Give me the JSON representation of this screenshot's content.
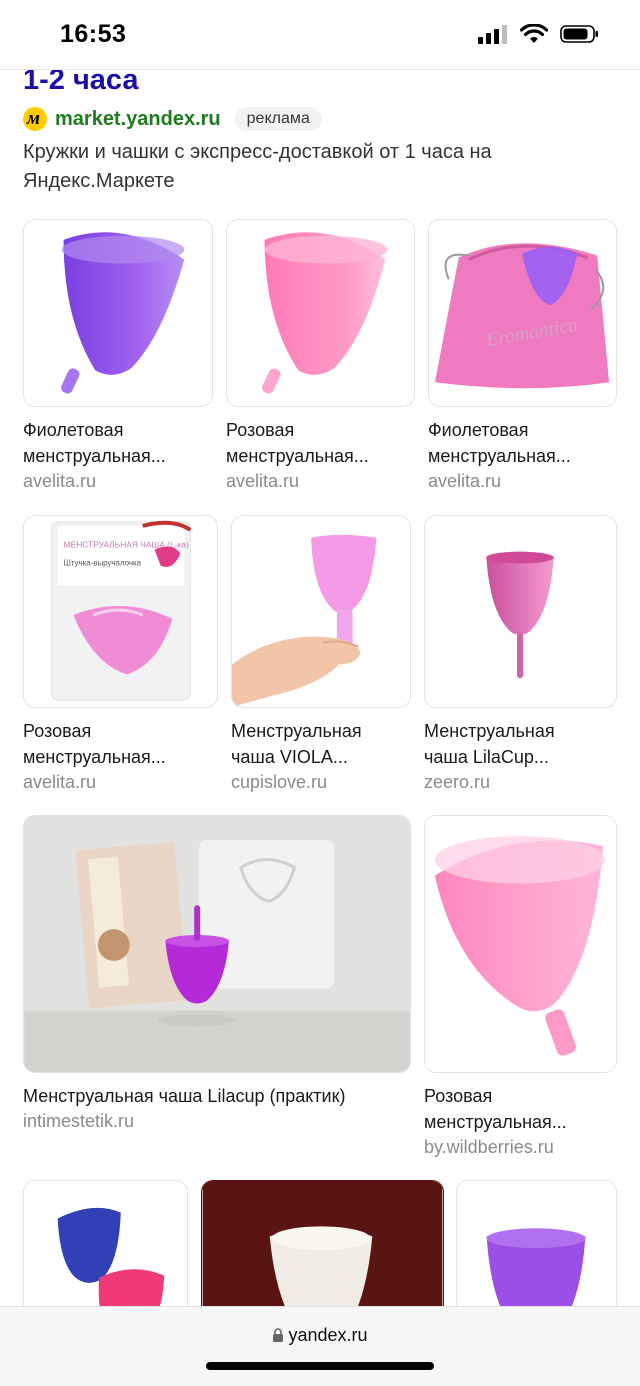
{
  "status": {
    "time": "16:53"
  },
  "ad": {
    "title": "1-2 часа",
    "domain": "market.yandex.ru",
    "badge": "реклама",
    "description": "Кружки и чашки с экспресс-доставкой от 1 часа на Яндекс.Маркете"
  },
  "results": [
    {
      "title1": "Фиолетовая",
      "title2": "менструальная...",
      "source": "avelita.ru"
    },
    {
      "title1": "Розовая",
      "title2": "менструальная...",
      "source": "avelita.ru"
    },
    {
      "title1": "Фиолетовая",
      "title2": "менструальная...",
      "source": "avelita.ru"
    },
    {
      "title1": "Розовая",
      "title2": "менструальная...",
      "source": "avelita.ru"
    },
    {
      "title1": "Менструальная",
      "title2": "чаша VIOLA...",
      "source": "cupislove.ru"
    },
    {
      "title1": "Менструальная",
      "title2": "чаша LilaCup...",
      "source": "zeero.ru"
    },
    {
      "title1": "Менструальная чаша Lilacup (практик)",
      "title2": "",
      "source": "intimestetik.ru"
    },
    {
      "title1": "Розовая",
      "title2": "менструальная...",
      "source": "by.wildberries.ru"
    }
  ],
  "image_text": {
    "bag_brand": "Eromantica",
    "package_title": "МЕНСТРУАЛЬНАЯ ЧАША (L-ка)",
    "package_sub": "Штучка-выручалочка"
  },
  "browser": {
    "url": "yandex.ru"
  },
  "colors": {
    "link": "#1a0dab",
    "domain": "#1e7b1e",
    "source": "#8a8a8a"
  }
}
